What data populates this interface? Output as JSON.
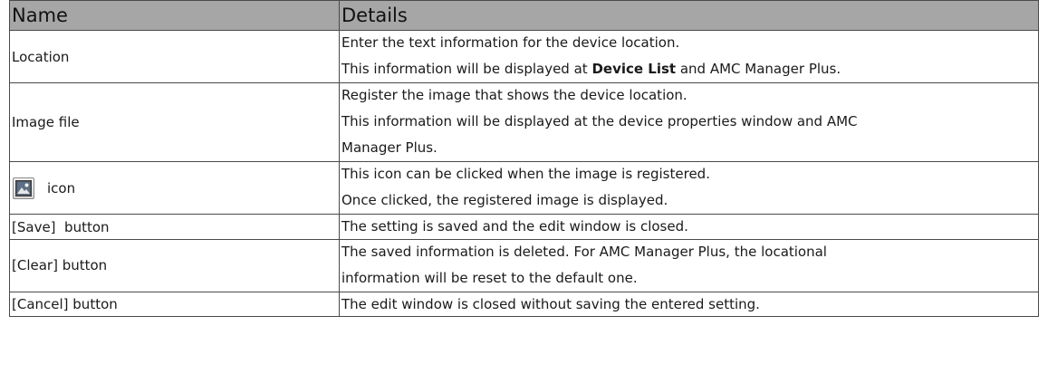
{
  "table": {
    "headers": {
      "name": "Name",
      "details": "Details"
    },
    "rows": [
      {
        "name": "Location",
        "details": [
          "Enter the text information for the device location.",
          {
            "pre": "This information will be displayed at ",
            "bold": "Device List",
            "post": " and AMC Manager Plus."
          }
        ]
      },
      {
        "name": "Image file",
        "details": [
          "Register the image that shows the device location.",
          "This information will be displayed at the device properties window and AMC",
          "Manager Plus."
        ]
      },
      {
        "name": "icon",
        "icon": "image-icon",
        "details": [
          "This icon can be clicked when the image is registered.",
          "Once clicked, the registered image is displayed."
        ]
      },
      {
        "name": "[Save]  button",
        "details": [
          "The setting is saved and the edit window is closed."
        ]
      },
      {
        "name": "[Clear] button",
        "details": [
          "The saved information is deleted.  For AMC Manager Plus, the locational",
          "information will be reset to the default one."
        ]
      },
      {
        "name": "[Cancel] button",
        "details": [
          "The edit window is closed without saving the entered setting."
        ]
      }
    ]
  }
}
